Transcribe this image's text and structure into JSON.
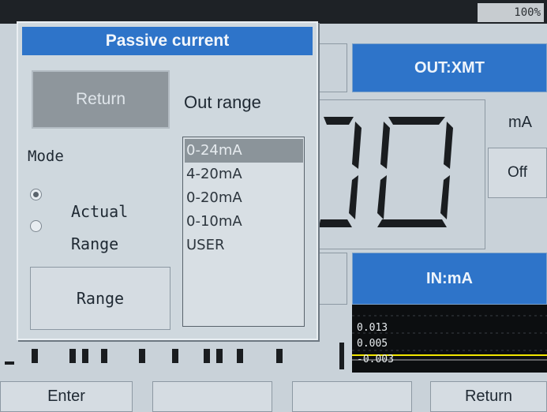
{
  "status_bar": {
    "battery": "100%"
  },
  "instrument": {
    "output_title": "OUT:XMT",
    "input_title": "IN:mA",
    "unit": "mA",
    "off_button": "Off",
    "display_digits": "00"
  },
  "graph": {
    "values": [
      "0.013",
      "0.005",
      "-0.003"
    ]
  },
  "dialog": {
    "title": "Passive current",
    "return_button": "Return",
    "out_range_label": "Out range",
    "mode_label": "Mode",
    "modes": [
      {
        "label": "Actual",
        "selected": true
      },
      {
        "label": "Range",
        "selected": false
      }
    ],
    "range_button": "Range",
    "range_options": [
      "0-24mA",
      "4-20mA",
      "0-20mA",
      "0-10mA",
      "USER"
    ],
    "selected_range": "0-24mA"
  },
  "softkeys": {
    "f1": "Enter",
    "f2": "",
    "f3": "",
    "f4": "Return"
  },
  "colors": {
    "title_blue": "#2e74c9",
    "screen_bg": "#c9d2d9",
    "graph_line": "#f2e600"
  }
}
